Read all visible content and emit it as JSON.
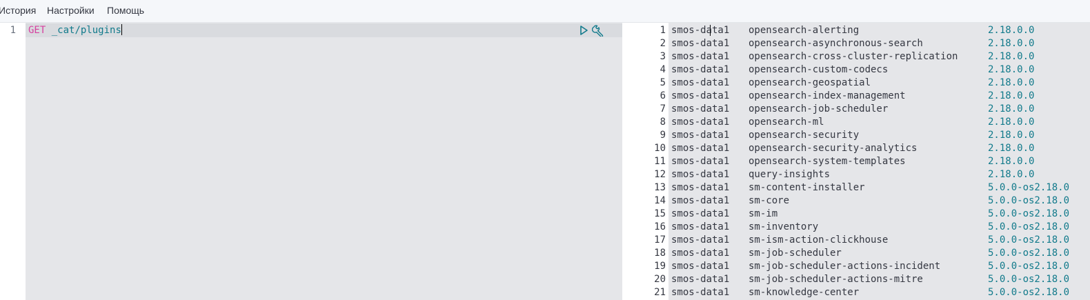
{
  "menu": {
    "items": [
      {
        "label": "История"
      },
      {
        "label": "Настройки"
      },
      {
        "label": "Помощь"
      }
    ]
  },
  "editor": {
    "line_number": "1",
    "method": "GET",
    "path": "_cat/plugins",
    "actions": [
      "play-icon",
      "wrench-icon"
    ]
  },
  "output": {
    "rows": [
      {
        "num": "1",
        "node": "smos-data1",
        "name": "opensearch-alerting",
        "version": "2.18.0.0"
      },
      {
        "num": "2",
        "node": "smos-data1",
        "name": "opensearch-asynchronous-search",
        "version": "2.18.0.0"
      },
      {
        "num": "3",
        "node": "smos-data1",
        "name": "opensearch-cross-cluster-replication",
        "version": "2.18.0.0"
      },
      {
        "num": "4",
        "node": "smos-data1",
        "name": "opensearch-custom-codecs",
        "version": "2.18.0.0"
      },
      {
        "num": "5",
        "node": "smos-data1",
        "name": "opensearch-geospatial",
        "version": "2.18.0.0"
      },
      {
        "num": "6",
        "node": "smos-data1",
        "name": "opensearch-index-management",
        "version": "2.18.0.0"
      },
      {
        "num": "7",
        "node": "smos-data1",
        "name": "opensearch-job-scheduler",
        "version": "2.18.0.0"
      },
      {
        "num": "8",
        "node": "smos-data1",
        "name": "opensearch-ml",
        "version": "2.18.0.0"
      },
      {
        "num": "9",
        "node": "smos-data1",
        "name": "opensearch-security",
        "version": "2.18.0.0"
      },
      {
        "num": "10",
        "node": "smos-data1",
        "name": "opensearch-security-analytics",
        "version": "2.18.0.0"
      },
      {
        "num": "11",
        "node": "smos-data1",
        "name": "opensearch-system-templates",
        "version": "2.18.0.0"
      },
      {
        "num": "12",
        "node": "smos-data1",
        "name": "query-insights",
        "version": "2.18.0.0"
      },
      {
        "num": "13",
        "node": "smos-data1",
        "name": "sm-content-installer",
        "version": "5.0.0-os2.18.0"
      },
      {
        "num": "14",
        "node": "smos-data1",
        "name": "sm-core",
        "version": "5.0.0-os2.18.0"
      },
      {
        "num": "15",
        "node": "smos-data1",
        "name": "sm-im",
        "version": "5.0.0-os2.18.0"
      },
      {
        "num": "16",
        "node": "smos-data1",
        "name": "sm-inventory",
        "version": "5.0.0-os2.18.0"
      },
      {
        "num": "17",
        "node": "smos-data1",
        "name": "sm-ism-action-clickhouse",
        "version": "5.0.0-os2.18.0"
      },
      {
        "num": "18",
        "node": "smos-data1",
        "name": "sm-job-scheduler",
        "version": "5.0.0-os2.18.0"
      },
      {
        "num": "19",
        "node": "smos-data1",
        "name": "sm-job-scheduler-actions-incident",
        "version": "5.0.0-os2.18.0"
      },
      {
        "num": "20",
        "node": "smos-data1",
        "name": "sm-job-scheduler-actions-mitre",
        "version": "5.0.0-os2.18.0"
      },
      {
        "num": "21",
        "node": "smos-data1",
        "name": "sm-knowledge-center",
        "version": "5.0.0-os2.18.0"
      }
    ]
  }
}
